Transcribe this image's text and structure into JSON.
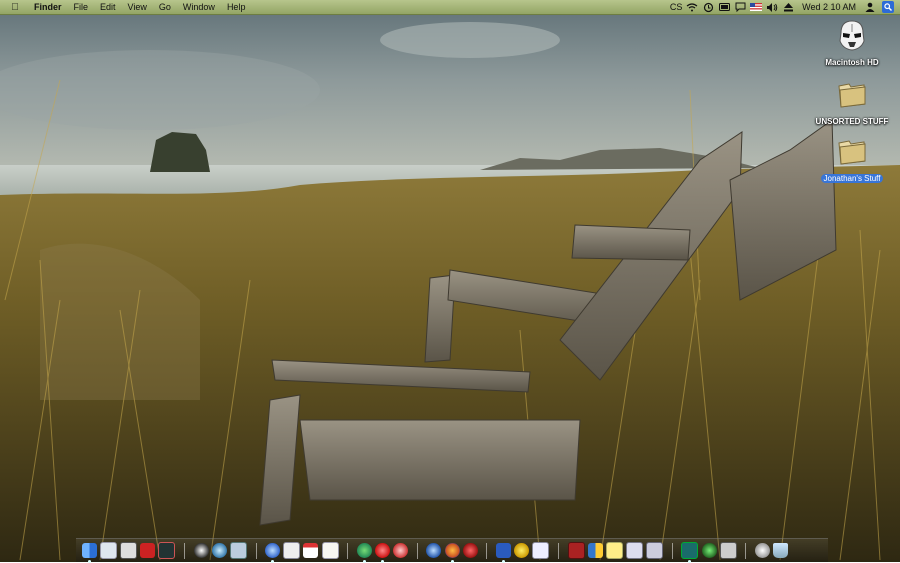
{
  "menubar": {
    "apple": "",
    "app_name": "Finder",
    "menus": [
      "File",
      "Edit",
      "View",
      "Go",
      "Window",
      "Help"
    ],
    "status": {
      "cs_label": "CS",
      "clock": "Wed 2 10 AM"
    }
  },
  "desktop": {
    "icons": [
      {
        "label": "Macintosh HD",
        "icon": "stormtrooper-drive-icon"
      },
      {
        "label": "UNSORTED STUFF",
        "icon": "folder-icon"
      },
      {
        "label": "Jonathan's Stuff",
        "icon": "folder-icon",
        "selected": true
      }
    ]
  },
  "dock": {
    "groups": [
      [
        "finder",
        "preview",
        "image-capture",
        "photo-booth",
        "front-row"
      ],
      [
        "dashboard",
        "spotlight",
        "calculator"
      ],
      [
        "ichat",
        "address-book",
        "ical",
        "textedit"
      ],
      [
        "itunes",
        "lastfm",
        "sims"
      ],
      [
        "safari",
        "firefox",
        "opera"
      ],
      [
        "word",
        "flash",
        "image-viewer"
      ],
      [
        "photoshop",
        "network",
        "stickies",
        "documents",
        "mail"
      ],
      [
        "terminal",
        "sims-2",
        "utilities"
      ],
      [
        "downloads",
        "trash"
      ]
    ]
  }
}
